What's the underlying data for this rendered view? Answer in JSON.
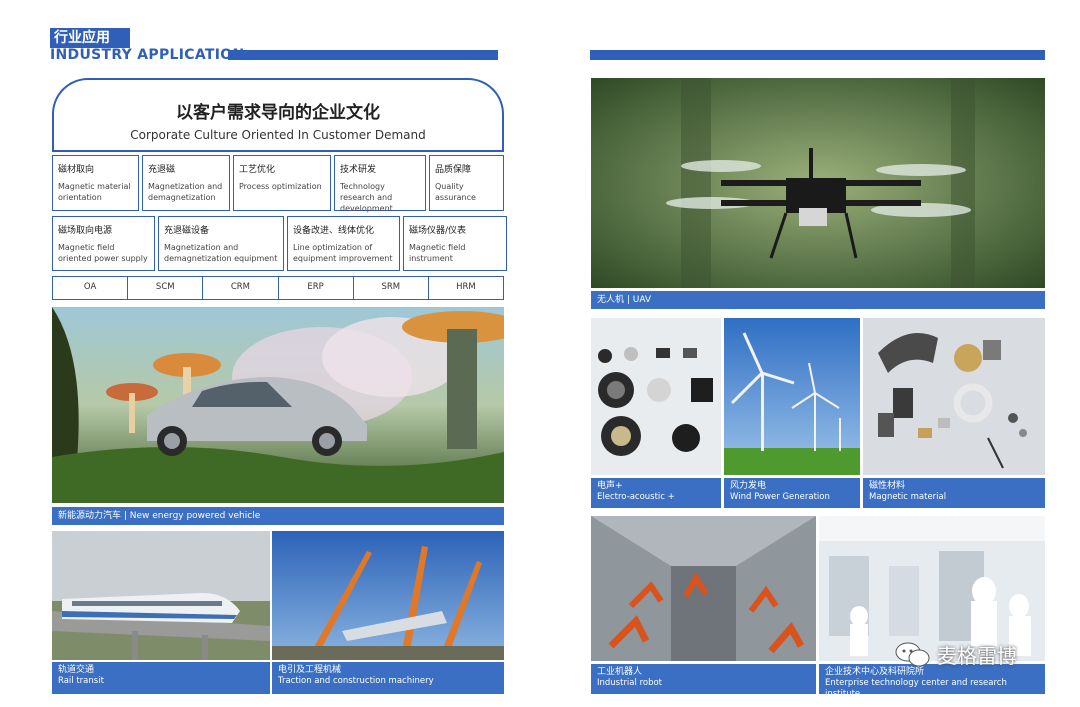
{
  "header": {
    "title_zh": "行业应用",
    "title_en": "INDUSTRY APPLICATION"
  },
  "culture": {
    "title_zh": "以客户需求导向的企业文化",
    "title_en": "Corporate Culture Oriented In Customer Demand"
  },
  "row1": [
    {
      "zh": "磁材取向",
      "en": "Magnetic material orientation"
    },
    {
      "zh": "充退磁",
      "en": "Magnetization and demagnetization"
    },
    {
      "zh": "工艺优化",
      "en": "Process optimization"
    },
    {
      "zh": "技术研发",
      "en": "Technology research and development"
    },
    {
      "zh": "品质保障",
      "en": "Quality assurance"
    }
  ],
  "row2": [
    {
      "zh": "磁场取向电源",
      "en": "Magnetic field oriented power supply"
    },
    {
      "zh": "充退磁设备",
      "en": "Magnetization and demagnetization equipment"
    },
    {
      "zh": "设备改进、线体优化",
      "en": "Line optimization of equipment improvement"
    },
    {
      "zh": "磁场仪器/仪表",
      "en": "Magnetic field instrument"
    }
  ],
  "systems": [
    "OA",
    "SCM",
    "CRM",
    "ERP",
    "SRM",
    "HRM"
  ],
  "captions": {
    "ev": "新能源动力汽车 | New energy powered vehicle",
    "rail_zh": "轨道交通",
    "rail_en": "Rail transit",
    "traction_zh": "电引及工程机械",
    "traction_en": "Traction and construction machinery",
    "uav": "无人机 | UAV",
    "acoustic_zh": "电声+",
    "acoustic_en": "Electro-acoustic +",
    "wind_zh": "风力发电",
    "wind_en": "Wind Power Generation",
    "magnet_zh": "磁性材料",
    "magnet_en": "Magnetic material",
    "robot_zh": "工业机器人",
    "robot_en": "Industrial robot",
    "center_zh": "企业技术中心及科研院所",
    "center_en": "Enterprise technology center and research institute"
  },
  "watermark": "麦格雷博"
}
